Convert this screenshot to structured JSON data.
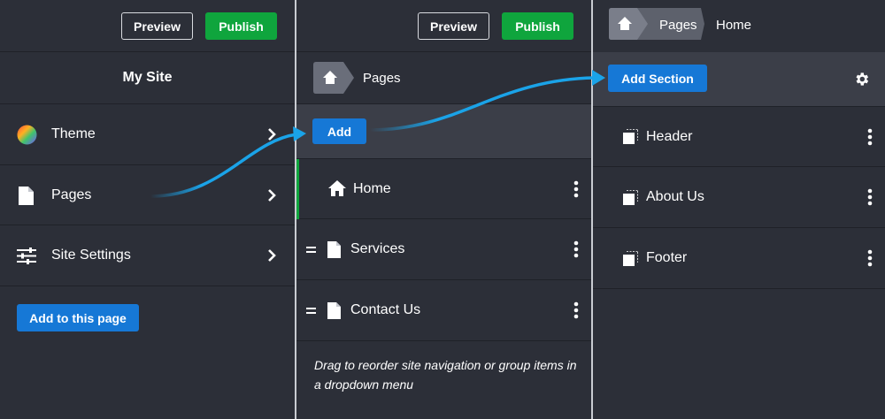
{
  "panel1": {
    "preview_label": "Preview",
    "publish_label": "Publish",
    "site_title": "My Site",
    "items": [
      {
        "label": "Theme",
        "icon": "color-wheel-icon"
      },
      {
        "label": "Pages",
        "icon": "page-icon"
      },
      {
        "label": "Site Settings",
        "icon": "sliders-icon"
      }
    ],
    "add_button_label": "Add to this page"
  },
  "panel2": {
    "preview_label": "Preview",
    "publish_label": "Publish",
    "breadcrumb": {
      "current": "Pages",
      "icon": "home-icon"
    },
    "add_button_label": "Add",
    "pages": [
      {
        "label": "Home",
        "icon": "home-icon",
        "active": true
      },
      {
        "label": "Services",
        "icon": "page-icon"
      },
      {
        "label": "Contact Us",
        "icon": "page-icon"
      }
    ],
    "hint": "Drag to reorder site navigation or group items in a dropdown menu"
  },
  "panel3": {
    "breadcrumb": {
      "parent": "Pages",
      "current": "Home",
      "icon": "home-icon"
    },
    "add_section_label": "Add Section",
    "sections": [
      {
        "label": "Header",
        "icon": "section-icon"
      },
      {
        "label": "About Us",
        "icon": "section-icon"
      },
      {
        "label": "Footer",
        "icon": "section-icon"
      }
    ]
  },
  "colors": {
    "background": "#2c2f38",
    "publish_green": "#0fa53d",
    "button_blue": "#1678d6",
    "arrow_blue": "#1aa3e8",
    "active_indicator": "#0fa53d"
  }
}
